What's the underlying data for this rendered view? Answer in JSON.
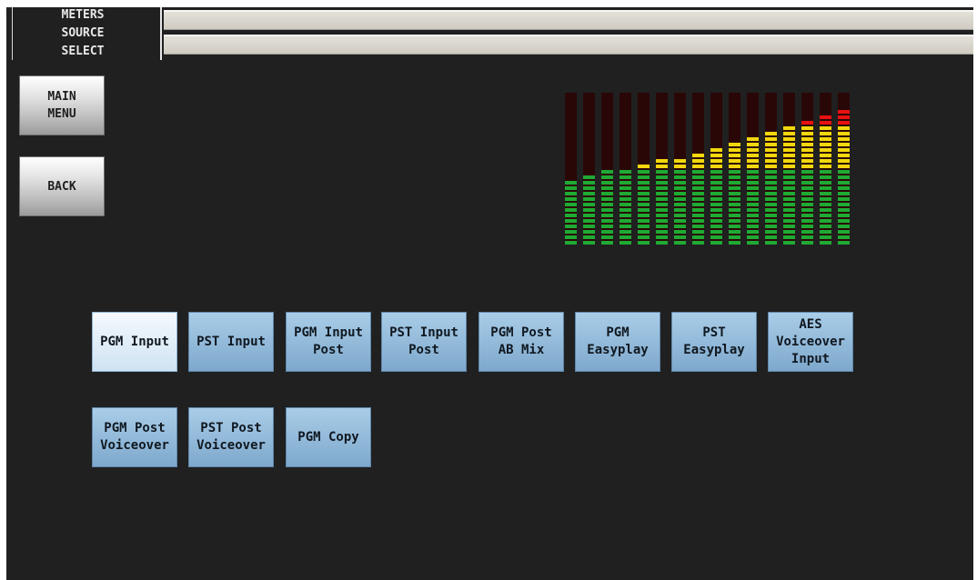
{
  "header": {
    "title_lines": [
      "METERS",
      "SOURCE",
      "SELECT"
    ]
  },
  "nav": {
    "main_menu_label": "MAIN\nMENU",
    "back_label": "BACK"
  },
  "meter": {
    "columns": 16,
    "levels": [
      0.45,
      0.48,
      0.5,
      0.52,
      0.56,
      0.58,
      0.61,
      0.63,
      0.66,
      0.7,
      0.74,
      0.78,
      0.82,
      0.86,
      0.9,
      0.93
    ],
    "colors": {
      "green": "#1faa34",
      "yellow": "#f2d70e",
      "red": "#e81010",
      "off": "#2a0707"
    }
  },
  "sources": {
    "selected_index": 0,
    "buttons": [
      "PGM Input",
      "PST Input",
      "PGM Input\nPost",
      "PST Input\nPost",
      "PGM Post\nAB Mix",
      "PGM\nEasyplay",
      "PST\nEasyplay",
      "AES\nVoiceover\nInput",
      "PGM Post\nVoiceover",
      "PST Post\nVoiceover",
      "PGM Copy"
    ]
  }
}
